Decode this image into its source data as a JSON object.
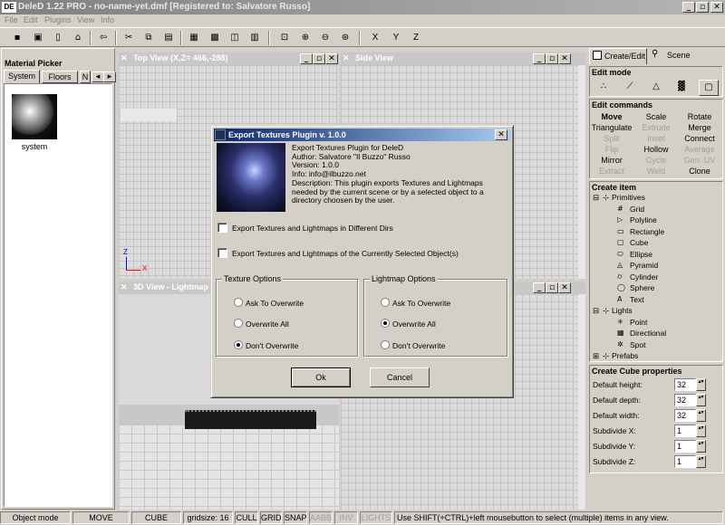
{
  "app": {
    "title_logo": "DE",
    "title": "DeleD 1.22 PRO - no-name-yet.dmf  [Registered to: Salvatore Russo]",
    "win_min": "_",
    "win_max": "▫",
    "win_close": "✕"
  },
  "menu": [
    "File",
    "Edit",
    "Plugins",
    "View",
    "Info"
  ],
  "toolbar": {
    "axes": [
      "X",
      "Y",
      "Z"
    ]
  },
  "material_picker": {
    "title": "Material Picker",
    "tabs": [
      "System",
      "Floors",
      "N"
    ],
    "material_name": "system"
  },
  "viewports": {
    "top": "Top View (X,Z= 466,-288)",
    "side": "Side View",
    "view3d": "3D View - Lightmap",
    "axis_x": "X",
    "axis_z": "Z"
  },
  "dialog": {
    "title": "Export Textures Plugin v. 1.0.0",
    "info": [
      "Export Textures Plugin for DeleD",
      " Author: Salvatore \"Il Buzzo\" Russo",
      " Version: 1.0.0",
      "Info: info@ilbuzzo.net",
      "Description: This plugin exports Textures and Lightmaps",
      "needed by the current scene or by a selected object to a",
      "directory choosen by the user."
    ],
    "check1": "Export Textures and Lightmaps in Different Dirs",
    "check2": "Export Textures and Lightmaps of the Currently Selected Object(s)",
    "texture_group": "Texture Options",
    "lightmap_group": "Lightmap Options",
    "texture_options": [
      "Ask To Overwrite",
      "Overwrite All",
      "Don't Overwrite"
    ],
    "texture_selected": 2,
    "lightmap_options": [
      "Ask To Overwrite",
      "Overwrite All",
      "Don't Overwrite"
    ],
    "lightmap_selected": 1,
    "ok": "Ok",
    "cancel": "Cancel"
  },
  "right_panel": {
    "tabs": [
      "Create/Edit",
      "Scene"
    ],
    "edit_mode": "Edit mode",
    "edit_commands": "Edit commands",
    "commands": [
      {
        "label": "Move",
        "enabled": true,
        "bold": true
      },
      {
        "label": "Scale",
        "enabled": true
      },
      {
        "label": "Rotate",
        "enabled": true
      },
      {
        "label": "Triangulate",
        "enabled": true
      },
      {
        "label": "Extrude",
        "enabled": false
      },
      {
        "label": "Merge",
        "enabled": true
      },
      {
        "label": "Split",
        "enabled": false
      },
      {
        "label": "Inset",
        "enabled": false
      },
      {
        "label": "Connect",
        "enabled": true
      },
      {
        "label": "Flip",
        "enabled": false
      },
      {
        "label": "Hollow",
        "enabled": true
      },
      {
        "label": "Average",
        "enabled": false
      },
      {
        "label": "Mirror",
        "enabled": true
      },
      {
        "label": "Cycle",
        "enabled": false
      },
      {
        "label": "Gen. UV",
        "enabled": false
      },
      {
        "label": "Extract",
        "enabled": false
      },
      {
        "label": "Weld",
        "enabled": false
      },
      {
        "label": "Clone",
        "enabled": true
      }
    ],
    "create_item": "Create item",
    "primitives": "Primitives",
    "primitive_items": [
      {
        "label": "Grid",
        "icon": "grid-icon",
        "glyph": "#"
      },
      {
        "label": "Polyline",
        "icon": "polyline-icon",
        "glyph": "▷"
      },
      {
        "label": "Rectangle",
        "icon": "rectangle-icon",
        "glyph": "▭"
      },
      {
        "label": "Cube",
        "icon": "cube-icon",
        "glyph": "▢"
      },
      {
        "label": "Ellipse",
        "icon": "ellipse-icon",
        "glyph": "⬭"
      },
      {
        "label": "Pyramid",
        "icon": "pyramid-icon",
        "glyph": "◬"
      },
      {
        "label": "Cylinder",
        "icon": "cylinder-icon",
        "glyph": "⌭"
      },
      {
        "label": "Sphere",
        "icon": "sphere-icon",
        "glyph": "◯"
      },
      {
        "label": "Text",
        "icon": "text-icon",
        "glyph": "A"
      }
    ],
    "lights": "Lights",
    "light_items": [
      {
        "label": "Point",
        "icon": "point-light-icon",
        "glyph": "✳"
      },
      {
        "label": "Directional",
        "icon": "directional-light-icon",
        "glyph": "▦"
      },
      {
        "label": "Spot",
        "icon": "spot-light-icon",
        "glyph": "✲"
      }
    ],
    "prefabs": "Prefabs",
    "properties_title": "Create Cube properties",
    "properties": [
      {
        "label": "Default height:",
        "value": "32"
      },
      {
        "label": "Default depth:",
        "value": "32"
      },
      {
        "label": "Default width:",
        "value": "32"
      },
      {
        "label": "Subdivide X:",
        "value": "1"
      },
      {
        "label": "Subdivide Y:",
        "value": "1"
      },
      {
        "label": "Subdivide Z:",
        "value": "1"
      }
    ]
  },
  "status": {
    "mode": "Object mode",
    "action": "MOVE",
    "primitive": "CUBE",
    "gridsize": "gridsize: 16",
    "cull": "CULL",
    "grid": "GRID",
    "snap": "SNAP",
    "aabb": "AABB",
    "inv": "INV",
    "lights": "LIGHTS",
    "hint": "Use SHIFT(+CTRL)+left mousebutton to select (multiple) items in any view."
  }
}
